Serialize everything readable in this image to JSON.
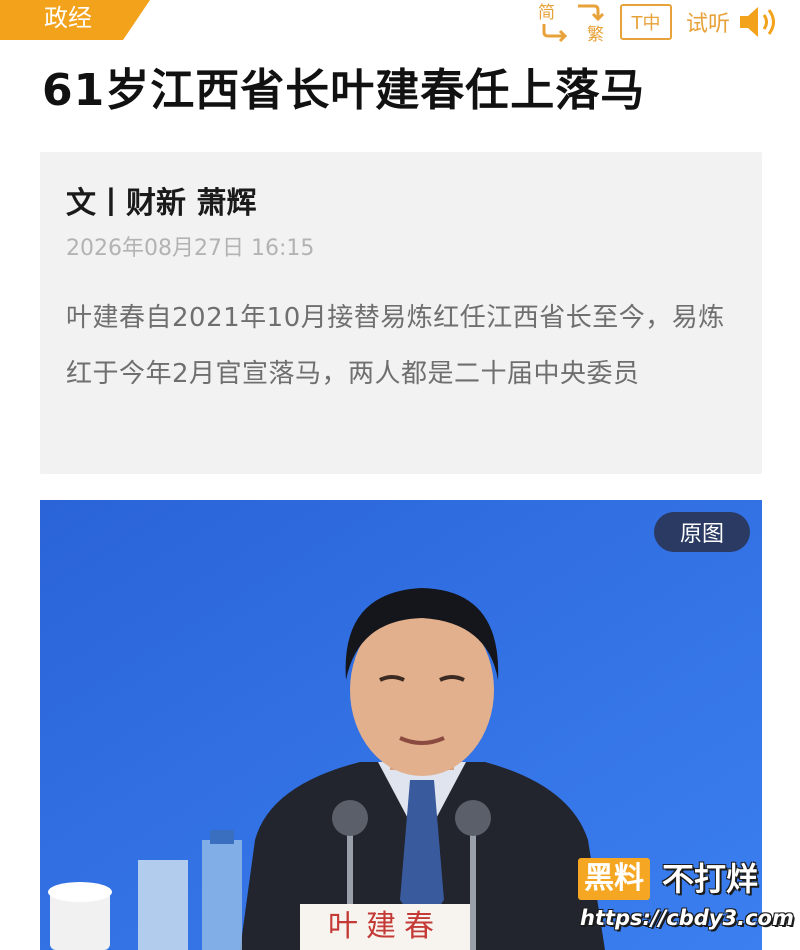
{
  "header": {
    "category": "政经",
    "simplified_label": "简",
    "traditional_label": "繁",
    "font_size_label": "T中",
    "listen_label": "试听",
    "accent_color": "#f3a21b"
  },
  "article": {
    "title": "61岁江西省长叶建春任上落马",
    "byline": "文丨财新 萧辉",
    "timestamp": "2026年08月27日 16:15",
    "summary": "叶建春自2021年10月接替易炼红任江西省长至今，易炼红于今年2月官宣落马，两人都是二十届中央委员"
  },
  "photo": {
    "original_label": "原图",
    "nameplate_text": "叶建春",
    "background_color": "#2f6ee0"
  },
  "watermark": {
    "box_text": "黑料",
    "rest_text": "不打烊",
    "url": "https://cbdy3.com"
  }
}
